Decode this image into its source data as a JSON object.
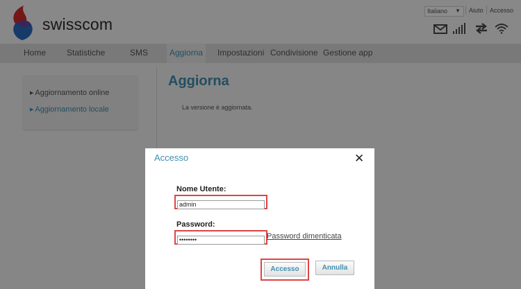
{
  "header": {
    "brand": "swisscom",
    "language": "Italiano",
    "help_link": "Aiuto",
    "login_link": "Accesso",
    "icons": [
      "mail-icon",
      "signal-icon",
      "transfer-icon",
      "wifi-icon"
    ]
  },
  "nav": {
    "items": [
      "Home",
      "Statistiche",
      "SMS",
      "Aggiorna",
      "Impostazioni",
      "Condivisione",
      "Gestione app"
    ],
    "active": "Aggiorna"
  },
  "sidebar": {
    "items": [
      "Aggiornamento online",
      "Aggiornamento locale"
    ],
    "active": "Aggiornamento locale"
  },
  "main": {
    "title": "Aggiorna",
    "message": "La versione è aggiornata."
  },
  "modal": {
    "title": "Accesso",
    "username_label": "Nome Utente:",
    "username_value": "admin",
    "password_label": "Password:",
    "password_value": "••••••••",
    "forgot_link": "Password dimenticata",
    "submit_label": "Accesso",
    "cancel_label": "Annulla"
  },
  "colors": {
    "accent": "#3f8fb0",
    "highlight": "#dd4444",
    "logo_red": "#d62a2a",
    "logo_blue": "#2a6cc0"
  }
}
